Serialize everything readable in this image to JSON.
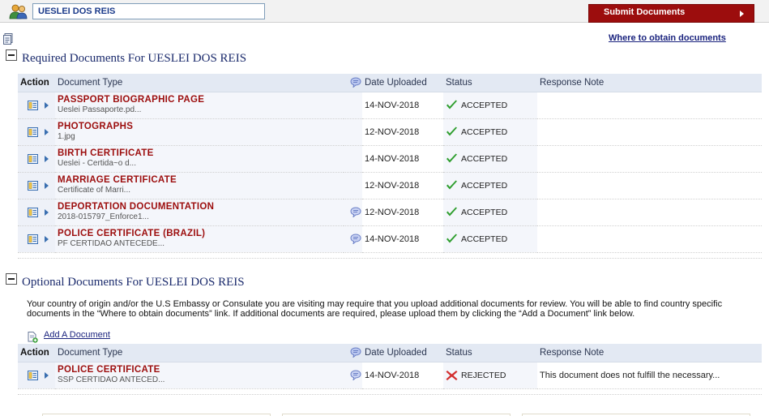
{
  "header": {
    "applicant_name": "UESLEI DOS REIS",
    "submit_label": "Submit Documents"
  },
  "links": {
    "where_to_obtain": "Where to obtain documents",
    "add_document": "Add A Document"
  },
  "required": {
    "title": "Required Documents For UESLEI DOS REIS",
    "columns": [
      "Action",
      "Document Type",
      "Date Uploaded",
      "Status",
      "Response Note"
    ],
    "rows": [
      {
        "type": "PASSPORT BIOGRAPHIC PAGE",
        "file": "Ueslei Passaporte.pd...",
        "has_comment": false,
        "date": "14-NOV-2018",
        "status": "ACCEPTED",
        "note": ""
      },
      {
        "type": "PHOTOGRAPHS",
        "file": "1.jpg",
        "has_comment": false,
        "date": "12-NOV-2018",
        "status": "ACCEPTED",
        "note": ""
      },
      {
        "type": "BIRTH CERTIFICATE",
        "file": "Ueslei - Certida~o d...",
        "has_comment": false,
        "date": "14-NOV-2018",
        "status": "ACCEPTED",
        "note": ""
      },
      {
        "type": "MARRIAGE CERTIFICATE",
        "file": "Certificate of Marri...",
        "has_comment": false,
        "date": "12-NOV-2018",
        "status": "ACCEPTED",
        "note": ""
      },
      {
        "type": "DEPORTATION DOCUMENTATION",
        "file": "2018-015797_Enforce1...",
        "has_comment": true,
        "date": "12-NOV-2018",
        "status": "ACCEPTED",
        "note": ""
      },
      {
        "type": "POLICE CERTIFICATE (BRAZIL)",
        "file": "PF CERTIDAO ANTECEDE...",
        "has_comment": true,
        "date": "14-NOV-2018",
        "status": "ACCEPTED",
        "note": ""
      }
    ]
  },
  "optional": {
    "title": "Optional Documents For UESLEI DOS REIS",
    "help_text": "Your country of origin and/or the U.S Embassy or Consulate you are visiting may require that you upload additional documents for review. You will be able to find country specific documents in the “Where to obtain documents” link. If additional documents are required, please upload them by clicking the “Add a Document” link below.",
    "columns": [
      "Action",
      "Document Type",
      "Date Uploaded",
      "Status",
      "Response Note"
    ],
    "rows": [
      {
        "type": "POLICE CERTIFICATE",
        "file": "SSP CERTIDAO ANTECED...",
        "has_comment": true,
        "date": "14-NOV-2018",
        "status": "REJECTED",
        "note": "This document does not fulfill the necessary..."
      }
    ]
  },
  "colors": {
    "brand_red": "#9c0d0d",
    "accepted_green": "#2e9e2e",
    "rejected_red": "#d32f2f",
    "title_navy": "#1a2a6c"
  }
}
